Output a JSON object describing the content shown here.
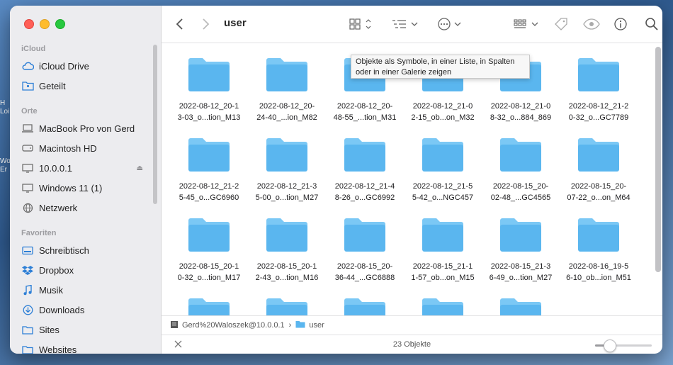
{
  "desktop": {
    "labels": [
      "H",
      "Loi",
      "Wo",
      "Er"
    ]
  },
  "window": {
    "title": "user"
  },
  "sidebar": {
    "sections": [
      {
        "label": "iCloud",
        "items": [
          {
            "label": "iCloud Drive",
            "icon": "cloud-icon"
          },
          {
            "label": "Geteilt",
            "icon": "shared-folder-icon"
          }
        ]
      },
      {
        "label": "Orte",
        "items": [
          {
            "label": "MacBook Pro von Gerd",
            "icon": "laptop-icon"
          },
          {
            "label": "Macintosh HD",
            "icon": "disk-icon"
          },
          {
            "label": "10.0.0.1",
            "icon": "display-icon",
            "eject": true
          },
          {
            "label": "Windows 11 (1)",
            "icon": "display-icon"
          },
          {
            "label": "Netzwerk",
            "icon": "globe-icon"
          }
        ]
      },
      {
        "label": "Favoriten",
        "items": [
          {
            "label": "Schreibtisch",
            "icon": "desktop-icon"
          },
          {
            "label": "Dropbox",
            "icon": "dropbox-icon"
          },
          {
            "label": "Musik",
            "icon": "music-icon"
          },
          {
            "label": "Downloads",
            "icon": "download-icon"
          },
          {
            "label": "Sites",
            "icon": "folder-icon"
          },
          {
            "label": "Websites",
            "icon": "folder-icon"
          }
        ]
      }
    ]
  },
  "tooltip": {
    "line1": "Objekte als Symbole, in einer Liste, in Spalten",
    "line2": "oder in einer Galerie zeigen"
  },
  "folders": [
    [
      "2022-08-12_20-1",
      "3-03_o...tion_M13"
    ],
    [
      "2022-08-12_20-",
      "24-40_...ion_M82"
    ],
    [
      "2022-08-12_20-",
      "48-55_...tion_M31"
    ],
    [
      "2022-08-12_21-0",
      "2-15_ob...on_M32"
    ],
    [
      "2022-08-12_21-0",
      "8-32_o...884_869"
    ],
    [
      "2022-08-12_21-2",
      "0-32_o...GC7789"
    ],
    [
      "2022-08-12_21-2",
      "5-45_o...GC6960"
    ],
    [
      "2022-08-12_21-3",
      "5-00_o...tion_M27"
    ],
    [
      "2022-08-12_21-4",
      "8-26_o...GC6992"
    ],
    [
      "2022-08-12_21-5",
      "5-42_o...NGC457"
    ],
    [
      "2022-08-15_20-",
      "02-48_...GC4565"
    ],
    [
      "2022-08-15_20-",
      "07-22_o...on_M64"
    ],
    [
      "2022-08-15_20-1",
      "0-32_o...tion_M17"
    ],
    [
      "2022-08-15_20-1",
      "2-43_o...tion_M16"
    ],
    [
      "2022-08-15_20-",
      "36-44_...GC6888"
    ],
    [
      "2022-08-15_21-1",
      "1-57_ob...on_M15"
    ],
    [
      "2022-08-15_21-3",
      "6-49_o...tion_M27"
    ],
    [
      "2022-08-16_19-5",
      "6-10_ob...ion_M51"
    ],
    [
      "",
      ""
    ],
    [
      "",
      ""
    ],
    [
      "",
      ""
    ],
    [
      "",
      ""
    ],
    [
      "",
      ""
    ]
  ],
  "pathbar": {
    "server": "Gerd%20Waloszek@10.0.0.1",
    "separator": "›",
    "folder": "user"
  },
  "status": {
    "text": "23 Objekte",
    "icon_size_level": 0.25
  },
  "colors": {
    "folder_top": "#7bc8f5",
    "folder_body": "#5ab6ef"
  }
}
